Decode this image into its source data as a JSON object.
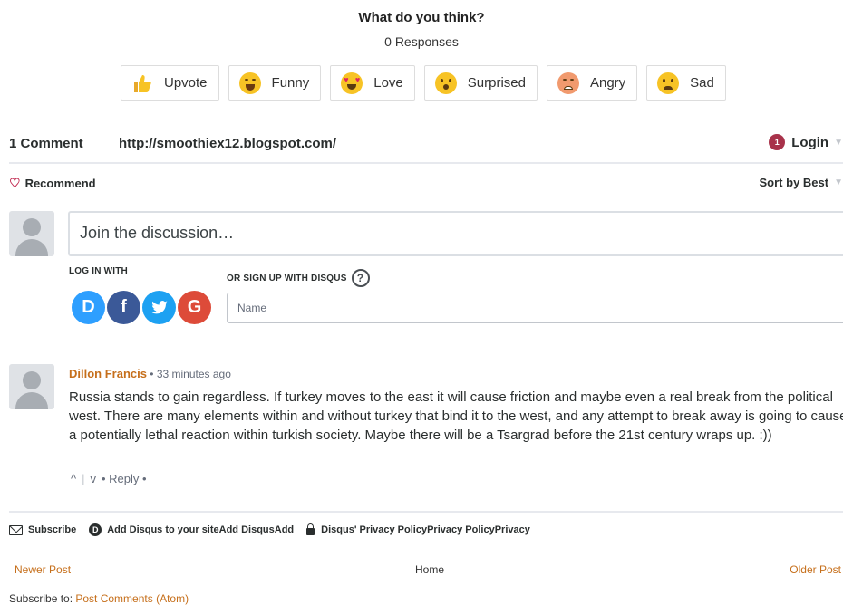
{
  "reactions": {
    "title": "What do you think?",
    "count": "0 Responses",
    "items": [
      {
        "label": "Upvote",
        "icon": "thumbs-up-icon"
      },
      {
        "label": "Funny",
        "icon": "laughing-face-icon"
      },
      {
        "label": "Love",
        "icon": "heart-eyes-face-icon"
      },
      {
        "label": "Surprised",
        "icon": "surprised-face-icon"
      },
      {
        "label": "Angry",
        "icon": "angry-face-icon"
      },
      {
        "label": "Sad",
        "icon": "sad-face-icon"
      }
    ]
  },
  "thread": {
    "comment_count": "1 Comment",
    "url": "http://smoothiex12.blogspot.com/",
    "login_badge": "1",
    "login_label": "Login",
    "recommend_label": "Recommend",
    "sort_label": "Sort by Best"
  },
  "composer": {
    "placeholder": "Join the discussion…",
    "login_with": "LOG IN WITH",
    "signup_with": "OR SIGN UP WITH DISQUS",
    "help": "?",
    "name_placeholder": "Name",
    "socials": [
      {
        "letter": "D",
        "icon": "disqus-icon"
      },
      {
        "letter": "f",
        "icon": "facebook-icon"
      },
      {
        "letter": "t",
        "icon": "twitter-icon"
      },
      {
        "letter": "G",
        "icon": "google-icon"
      }
    ]
  },
  "comment": {
    "author": "Dillon Francis",
    "time": " • 33 minutes ago",
    "text": "Russia stands to gain regardless. If turkey moves to the east it will cause friction and maybe even a real break from the political west. There are many elements within and without turkey that bind it to the west, and any attempt to break away is going to cause a potentially lethal reaction within turkish society. Maybe there will be a Tsargrad before the 21st century wraps up. :))",
    "upvote": "^",
    "sep": "|",
    "downvote": "v",
    "reply": "• Reply •"
  },
  "footer": {
    "subscribe": "Subscribe",
    "add_disqus": "Add Disqus to your siteAdd DisqusAdd",
    "privacy": "Disqus' Privacy PolicyPrivacy PolicyPrivacy"
  },
  "blog_nav": {
    "newer": "Newer Post",
    "home": "Home",
    "older": "Older Post",
    "subscribe_prefix": "Subscribe to: ",
    "subscribe_link": "Post Comments (Atom)"
  },
  "colors": {
    "accent": "#c66f1b",
    "login_badge": "#a8324a",
    "disqus_blue": "#2e9fff",
    "facebook": "#3b5998",
    "twitter": "#1da1f2",
    "google": "#dd4b39"
  }
}
